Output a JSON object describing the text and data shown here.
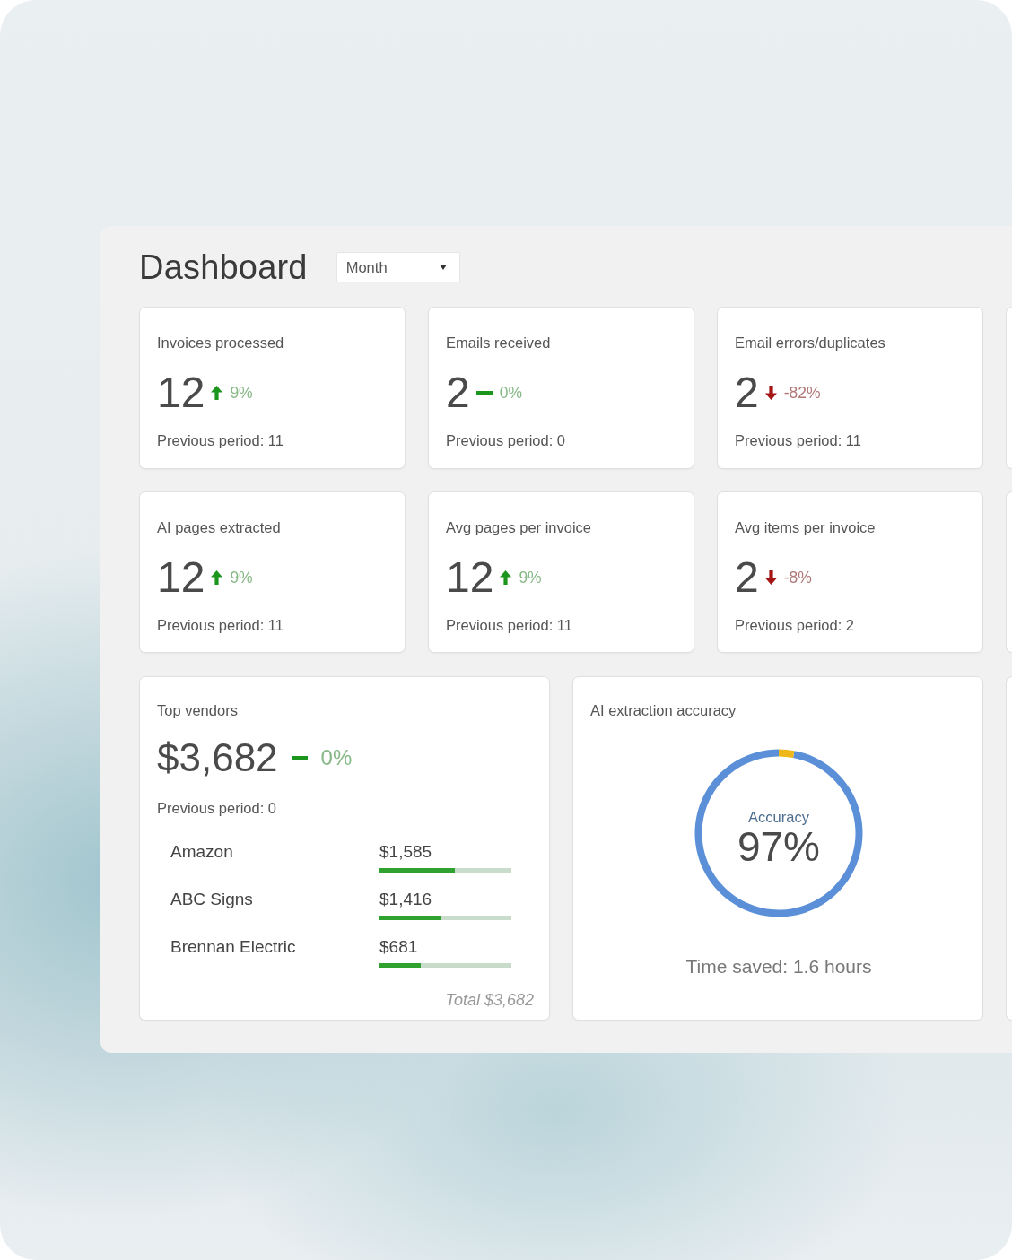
{
  "title": "Dashboard",
  "period_select": {
    "value": "Month"
  },
  "stat_cards": [
    {
      "label": "Invoices processed",
      "value": "12",
      "kind": "up",
      "change": "9%",
      "previous": "Previous period: 11"
    },
    {
      "label": "Emails received",
      "value": "2",
      "kind": "flat",
      "change": "0%",
      "previous": "Previous period: 0"
    },
    {
      "label": "Email errors/duplicates",
      "value": "2",
      "kind": "down",
      "change": "-82%",
      "previous": "Previous period: 11"
    },
    {
      "label": "AI pages extracted",
      "value": "12",
      "kind": "up",
      "change": "9%",
      "previous": "Previous period: 11"
    },
    {
      "label": "Avg pages per invoice",
      "value": "12",
      "kind": "up",
      "change": "9%",
      "previous": "Previous period: 11"
    },
    {
      "label": "Avg items per invoice",
      "value": "2",
      "kind": "down",
      "change": "-8%",
      "previous": "Previous period: 2"
    }
  ],
  "top_vendors": {
    "title": "Top vendors",
    "value": "$3,682",
    "kind": "flat",
    "change": "0%",
    "previous": "Previous period: 0",
    "vendors": [
      {
        "name": "Amazon",
        "amount": "$1,585",
        "level": 0.57
      },
      {
        "name": "ABC Signs",
        "amount": "$1,416",
        "level": 0.47
      },
      {
        "name": "Brennan Electric",
        "amount": "$681",
        "level": 0.31
      }
    ],
    "total": "Total $3,682"
  },
  "accuracy": {
    "title": "AI extraction accuracy",
    "chart_data": {
      "type": "donut",
      "values": [
        97,
        3
      ]
    },
    "label": "Accuracy",
    "value": "97%",
    "time_saved": "Time saved: 1.6 hours"
  }
}
